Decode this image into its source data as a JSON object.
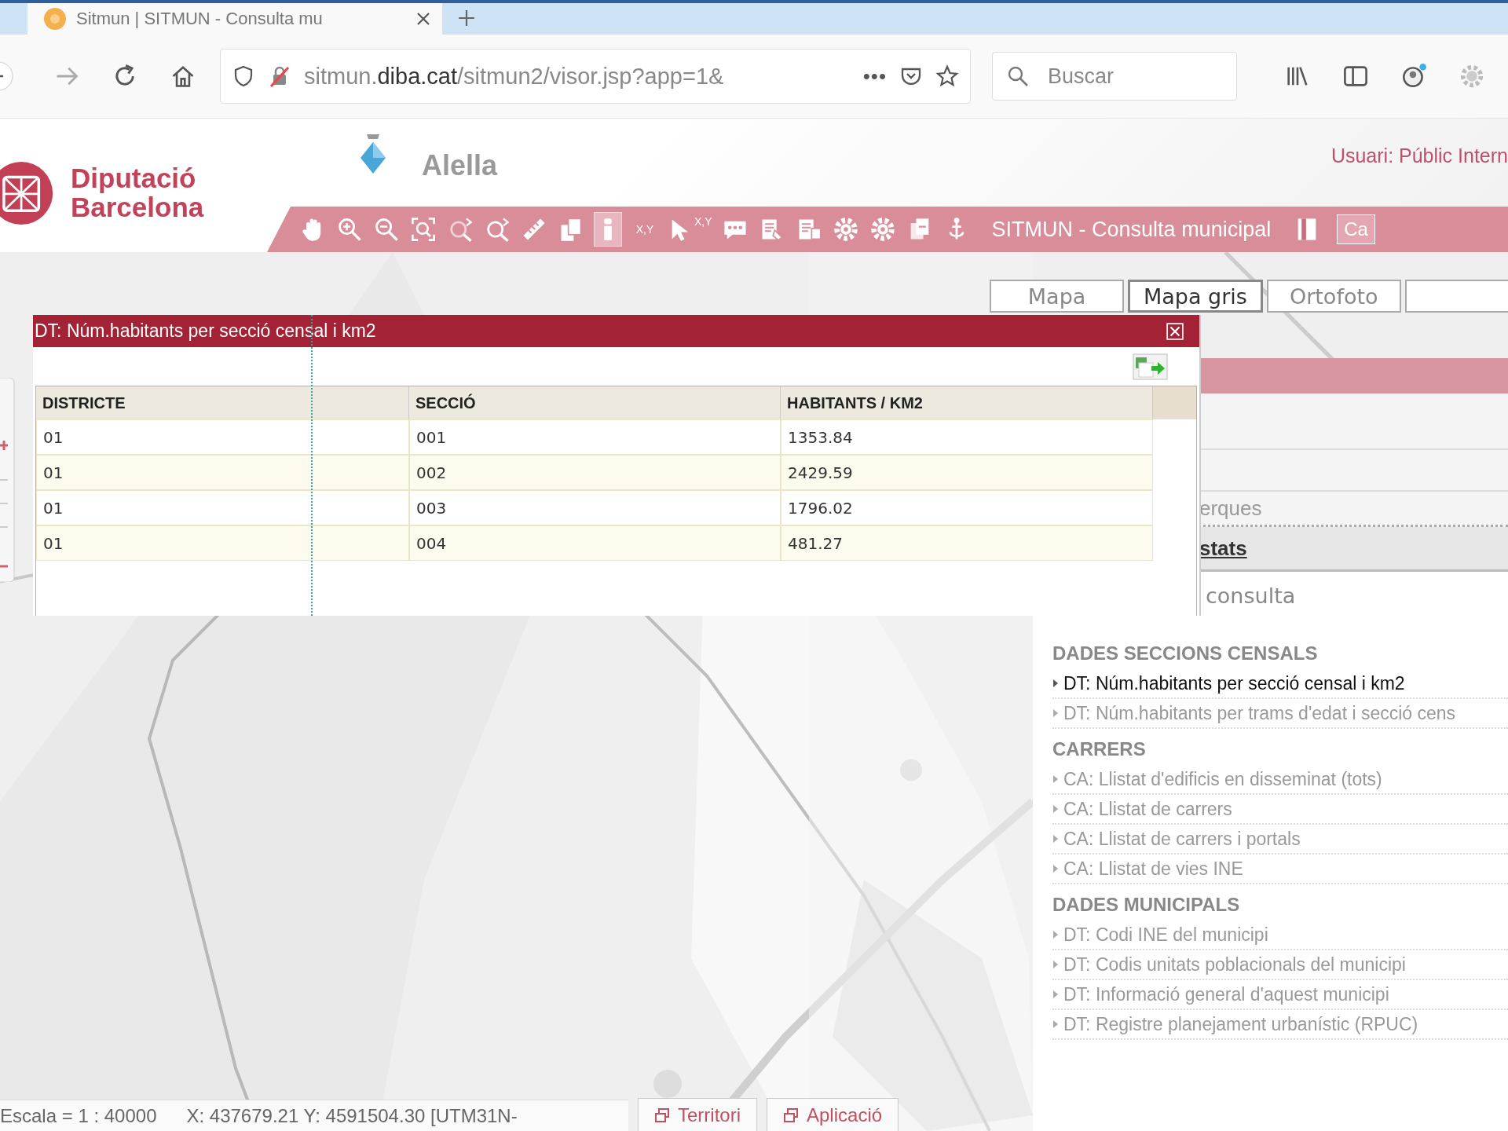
{
  "browser": {
    "tab": {
      "title": "Sitmun | SITMUN - Consulta mu",
      "selected": true
    },
    "url": {
      "prefix": "sitmun.",
      "domain": "diba.cat",
      "path": "/sitmun2/visor.jsp?app=1&"
    },
    "page_actions": "•••",
    "search": {
      "placeholder": "Buscar"
    }
  },
  "header": {
    "brand": [
      "Diputació",
      "Barcelona"
    ],
    "municipality": "Alella",
    "user": "Usuari: Públic Intern"
  },
  "toolbar": {
    "tools": [
      {
        "kind": "hand",
        "selected": false
      },
      {
        "kind": "zoom-in",
        "selected": false
      },
      {
        "kind": "zoom-out",
        "selected": false
      },
      {
        "kind": "zoom-extent",
        "selected": false
      },
      {
        "kind": "zoom-back",
        "selected": false
      },
      {
        "kind": "zoom-forward",
        "selected": false
      },
      {
        "kind": "ruler",
        "selected": false
      },
      {
        "kind": "pages",
        "selected": false
      },
      {
        "kind": "info",
        "selected": true
      },
      {
        "kind": "xy",
        "label": "X,Y",
        "selected": false
      },
      {
        "kind": "pointer-xy",
        "label": "X,Y",
        "selected": false
      },
      {
        "kind": "comment",
        "selected": false
      },
      {
        "kind": "print",
        "selected": false
      },
      {
        "kind": "report",
        "selected": false
      },
      {
        "kind": "gear",
        "selected": false
      },
      {
        "kind": "gear",
        "selected": false
      },
      {
        "kind": "layers",
        "selected": false
      },
      {
        "kind": "download",
        "selected": false
      }
    ],
    "title": "SITMUN - Consulta municipal",
    "cut_button": "Ca"
  },
  "base_layers": [
    {
      "label": "Mapa",
      "selected": false
    },
    {
      "label": "Mapa gris",
      "selected": true
    },
    {
      "label": "Ortofoto",
      "selected": false
    },
    {
      "selected": false
    }
  ],
  "popup": {
    "title": "DT: Núm.habitants per secció censal i km2",
    "table": {
      "columns": [
        "DISTRICTE",
        "SECCIÓ",
        "HABITANTS / KM2"
      ],
      "rows": [
        [
          "01",
          "001",
          "1353.84"
        ],
        [
          "01",
          "002",
          "2429.59"
        ],
        [
          "01",
          "003",
          "1796.02"
        ],
        [
          "01",
          "004",
          "481.27"
        ]
      ]
    }
  },
  "side_panel": {
    "partial_texts": [
      "erques",
      "stats",
      "consulta"
    ],
    "groups": [
      {
        "heading": "DADES SECCIONS CENSALS",
        "items": [
          {
            "label": "DT: Núm.habitants per secció censal i km2",
            "selected": true
          },
          {
            "label": "DT: Núm.habitants per trams d'edat i secció cens",
            "selected": false
          }
        ]
      },
      {
        "heading": "CARRERS",
        "items": [
          {
            "label": "CA: Llistat d'edificis en disseminat (tots)",
            "selected": false
          },
          {
            "label": "CA: Llistat de carrers",
            "selected": false
          },
          {
            "label": "CA: Llistat de carrers i portals",
            "selected": false
          },
          {
            "label": "CA: Llistat de vies INE",
            "selected": false
          }
        ]
      },
      {
        "heading": "DADES MUNICIPALS",
        "items": [
          {
            "label": "DT: Codi INE del municipi",
            "selected": false
          },
          {
            "label": "DT: Codis unitats poblacionals del municipi",
            "selected": false
          },
          {
            "label": "DT: Informació general d'aquest municipi",
            "selected": false
          },
          {
            "label": "DT: Registre planejament urbanístic (RPUC)",
            "selected": false
          }
        ]
      }
    ]
  },
  "status_bar": {
    "scale": "Escala = 1 : 40000",
    "coordinates": "X: 437679.21 Y: 4591504.30 [UTM31N-",
    "buttons": [
      "Territori",
      "Aplicació"
    ]
  }
}
